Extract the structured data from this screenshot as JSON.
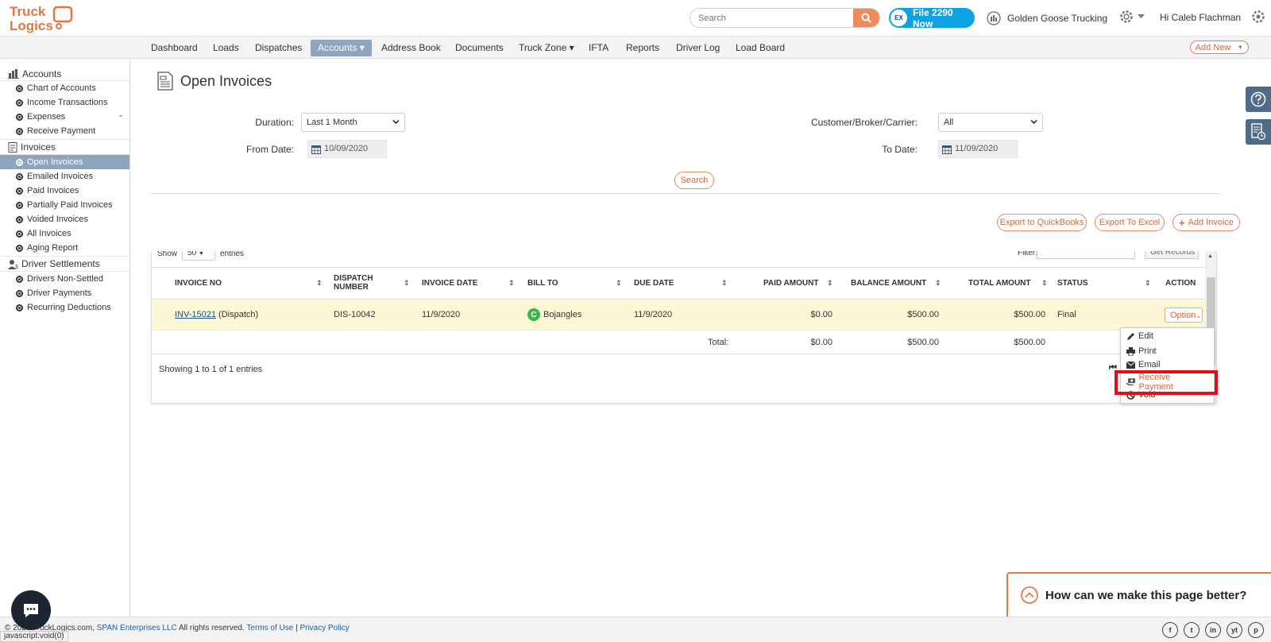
{
  "header": {
    "logo_line1": "Truck",
    "logo_line2": "Logics",
    "search_placeholder": "Search",
    "file2290_label": "File 2290 Now",
    "file2290_badge": "EX",
    "company_name": "Golden Goose Trucking",
    "greeting": "Hi Caleb Flachman"
  },
  "nav": {
    "items": [
      "Dashboard",
      "Loads",
      "Dispatches",
      "Accounts",
      "Address Book",
      "Documents",
      "Truck Zone",
      "IFTA",
      "Reports",
      "Driver Log",
      "Load Board"
    ],
    "active": "Accounts",
    "add_new": "Add New"
  },
  "sidebar": {
    "accounts_title": "Accounts",
    "accounts_items": [
      "Chart of Accounts",
      "Income Transactions",
      "Expenses",
      "Receive Payment"
    ],
    "invoices_title": "Invoices",
    "invoices_items": [
      "Open Invoices",
      "Emailed Invoices",
      "Paid Invoices",
      "Partially Paid Invoices",
      "Voided Invoices",
      "All Invoices",
      "Aging Report"
    ],
    "active_item": "Open Invoices",
    "settlements_title": "Driver Settlements",
    "settlements_items": [
      "Drivers Non-Settled",
      "Driver Payments",
      "Recurring Deductions"
    ]
  },
  "page": {
    "title": "Open Invoices",
    "duration_label": "Duration:",
    "duration_value": "Last 1 Month",
    "customer_label": "Customer/Broker/Carrier:",
    "customer_value": "All",
    "from_label": "From Date:",
    "from_value": "10/09/2020",
    "to_label": "To Date:",
    "to_value": "11/09/2020",
    "search_button": "Search",
    "export_qb": "Export to QuickBooks",
    "export_excel": "Export To Excel",
    "add_invoice": "Add Invoice"
  },
  "table": {
    "show_label": "Show",
    "show_value": "50",
    "entries_label": "entries",
    "filter_label": "Filter:",
    "get_records": "Get Records",
    "columns": [
      "INVOICE NO",
      "DISPATCH NUMBER",
      "INVOICE DATE",
      "BILL TO",
      "DUE DATE",
      "PAID AMOUNT",
      "BALANCE AMOUNT",
      "TOTAL AMOUNT",
      "STATUS",
      "ACTION"
    ],
    "dispatch_col_line1": "DISPATCH",
    "dispatch_col_line2": "NUMBER",
    "rows": [
      {
        "invoice_no": "INV-15021",
        "invoice_type": "(Dispatch)",
        "dispatch_number": "DIS-10042",
        "invoice_date": "11/9/2020",
        "bill_to_badge": "C",
        "bill_to": "Bojangles",
        "due_date": "11/9/2020",
        "paid_amount": "$0.00",
        "balance_amount": "$500.00",
        "total_amount": "$500.00",
        "status": "Final",
        "action": "Option"
      }
    ],
    "totals": {
      "label": "Total:",
      "paid": "$0.00",
      "balance": "$500.00",
      "total": "$500.00"
    },
    "showing_text": "Showing 1 to 1 of 1 entries"
  },
  "option_menu": {
    "items": [
      "Edit",
      "Print",
      "Email",
      "Receive Payment",
      "Void"
    ],
    "highlighted": "Receive Payment"
  },
  "feedback": {
    "text": "How can we make this page better?"
  },
  "footer": {
    "copyright_prefix": "© 2020 TruckLogics.com,",
    "company_link": "SPAN Enterprises LLC",
    "rights": "All rights reserved.",
    "terms": "Terms of Use",
    "privacy": "Privacy Policy",
    "social": [
      "f",
      "t",
      "in",
      "yt",
      "p"
    ]
  },
  "status_bar": {
    "url": "javascript:void(0)"
  },
  "colors": {
    "brand_orange": "#f08a5d",
    "nav_active": "#8fa4bd",
    "row_highlight": "#fcf8d6",
    "file2290_blue": "#0da3e2",
    "highlight_red": "#e20f1a",
    "badge_green": "#3cb84a"
  }
}
